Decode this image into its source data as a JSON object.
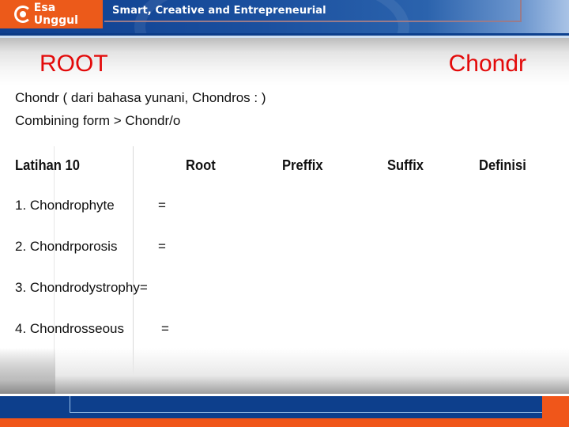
{
  "header": {
    "logo_text": "Esa Unggul",
    "tagline": "Smart, Creative and Entrepreneurial",
    "logo_color": "#ec5a1a",
    "banner_color": "#1a4f9e"
  },
  "title": {
    "left": "ROOT",
    "right": "Chondr",
    "color": "#e30a0a"
  },
  "intro": {
    "line1": "Chondr ( dari bahasa yunani, Chondros : )",
    "line2": "Combining form   > Chondr/o"
  },
  "table": {
    "headers": [
      "Latihan 10",
      "Root",
      "Preffix",
      "Suffix",
      "Definisi"
    ],
    "items": [
      {
        "term": "1. Chondrophyte",
        "eq": "="
      },
      {
        "term": "2. Chondrporosis",
        "eq": "="
      },
      {
        "term": "3. Chondrodystrophy=",
        "eq": ""
      },
      {
        "term": "4. Chondrosseous",
        "eq": "="
      }
    ]
  },
  "footer": {
    "blue": "#0d3f8c",
    "orange": "#f0561a"
  }
}
